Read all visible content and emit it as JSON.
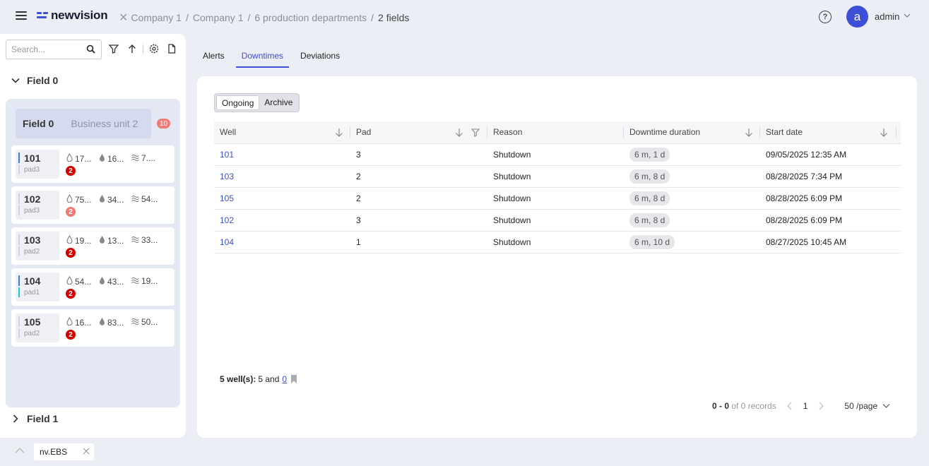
{
  "app": {
    "logo_text": "newvision",
    "breadcrumbs": [
      "Company 1",
      "Company 1",
      "6 production departments",
      "2 fields"
    ],
    "help_glyph": "?",
    "user_initial": "a",
    "user_name": "admin"
  },
  "sidebar": {
    "search_placeholder": "Search...",
    "field0_title": "Field 0",
    "field1_title": "Field 1",
    "bu_card": {
      "field": "Field 0",
      "unit": "Business unit 2",
      "badge": "10"
    },
    "wells": [
      {
        "id": "101",
        "pad": "pad3",
        "m1": "17...",
        "m2": "16...",
        "m3": "7....",
        "alerts": "2",
        "bar_top": "#3c7be0",
        "bar_bottom": "#d0d3da",
        "badge_color": "#d40000"
      },
      {
        "id": "102",
        "pad": "pad3",
        "m1": "75...",
        "m2": "34...",
        "m3": "54...",
        "alerts": "2",
        "bar_top": "#d0d3da",
        "bar_bottom": "#d0d3da",
        "badge_color": "#f07b76"
      },
      {
        "id": "103",
        "pad": "pad2",
        "m1": "19...",
        "m2": "13...",
        "m3": "33...",
        "alerts": "2",
        "bar_top": "#d0d3da",
        "bar_bottom": "#d0d3da",
        "badge_color": "#d40000"
      },
      {
        "id": "104",
        "pad": "pad1",
        "m1": "54...",
        "m2": "43...",
        "m3": "19...",
        "alerts": "2",
        "bar_top": "#3c7be0",
        "bar_bottom": "#1ec3d6",
        "badge_color": "#d40000"
      },
      {
        "id": "105",
        "pad": "pad2",
        "m1": "16...",
        "m2": "83...",
        "m3": "50...",
        "alerts": "2",
        "bar_top": "#d0d3da",
        "bar_bottom": "#d0d3da",
        "badge_color": "#d40000"
      }
    ]
  },
  "tabs": [
    "Alerts",
    "Downtimes",
    "Deviations"
  ],
  "segment": [
    "Ongoing",
    "Archive"
  ],
  "table": {
    "columns": [
      "Well",
      "Pad",
      "Reason",
      "Downtime duration",
      "Start date"
    ],
    "rows": [
      {
        "well": "101",
        "pad": "3",
        "reason": "Shutdown",
        "duration": "6 m, 1 d",
        "start": "09/05/2025 12:35 AM"
      },
      {
        "well": "103",
        "pad": "2",
        "reason": "Shutdown",
        "duration": "6 m, 8 d",
        "start": "08/28/2025 7:34 PM"
      },
      {
        "well": "105",
        "pad": "2",
        "reason": "Shutdown",
        "duration": "6 m, 8 d",
        "start": "08/28/2025 6:09 PM"
      },
      {
        "well": "102",
        "pad": "3",
        "reason": "Shutdown",
        "duration": "6 m, 8 d",
        "start": "08/28/2025 6:09 PM"
      },
      {
        "well": "104",
        "pad": "1",
        "reason": "Shutdown",
        "duration": "6 m, 10 d",
        "start": "08/27/2025 10:45 AM"
      }
    ]
  },
  "footer": {
    "wells_label": "5 well(s):",
    "wells_text": "5 and",
    "wells_link": "0",
    "records_range": "0 - 0",
    "records_text": "of 0 records",
    "page": "1",
    "per_page": "50 /page"
  },
  "tray": {
    "tab_label": "nv.EBS"
  },
  "colors": {
    "accent": "#3c4fd6",
    "alert_red": "#d40000",
    "alert_light": "#f07b76"
  }
}
